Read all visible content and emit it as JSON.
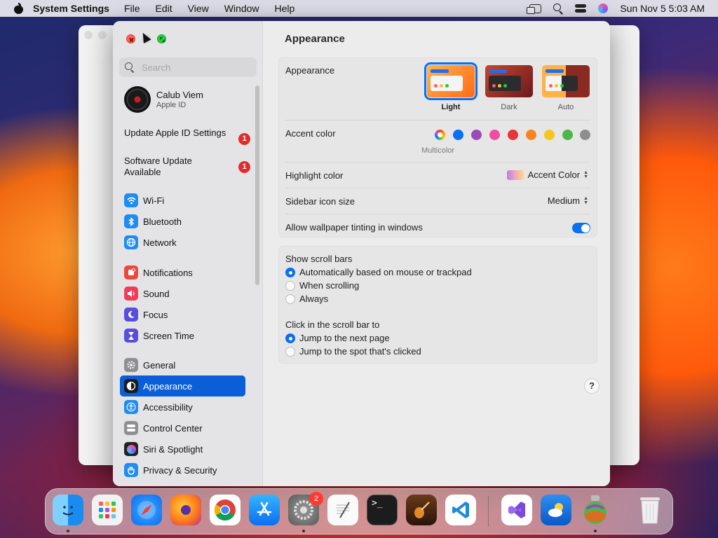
{
  "menubar": {
    "app_name": "System Settings",
    "menus": [
      "File",
      "Edit",
      "View",
      "Window",
      "Help"
    ],
    "clock": "Sun Nov 5  5:03 AM"
  },
  "sidebar": {
    "search_placeholder": "Search",
    "user": {
      "name": "Calub Viem",
      "subtitle": "Apple ID"
    },
    "alerts": [
      {
        "label": "Update Apple ID Settings",
        "badge": "1"
      },
      {
        "label": "Software Update Available",
        "badge": "1"
      }
    ],
    "items": [
      {
        "label": "Wi-Fi",
        "icon": "wifi-icon",
        "color": "#1e8cf0"
      },
      {
        "label": "Bluetooth",
        "icon": "bluetooth-icon",
        "color": "#1e8cf0"
      },
      {
        "label": "Network",
        "icon": "globe-icon",
        "color": "#1e8cf0"
      },
      {
        "label": "Notifications",
        "icon": "bell-icon",
        "color": "#f0463c"
      },
      {
        "label": "Sound",
        "icon": "speaker-icon",
        "color": "#f03c5a"
      },
      {
        "label": "Focus",
        "icon": "moon-icon",
        "color": "#5a4cdc"
      },
      {
        "label": "Screen Time",
        "icon": "hourglass-icon",
        "color": "#5a4cdc"
      },
      {
        "label": "General",
        "icon": "gear-icon",
        "color": "#8e8e93"
      },
      {
        "label": "Appearance",
        "icon": "appearance-icon",
        "color": "#1c1c1e",
        "active": true
      },
      {
        "label": "Accessibility",
        "icon": "accessibility-icon",
        "color": "#1e8cf0"
      },
      {
        "label": "Control Center",
        "icon": "control-center-icon",
        "color": "#8e8e93"
      },
      {
        "label": "Siri & Spotlight",
        "icon": "siri-icon",
        "color": "#222"
      },
      {
        "label": "Privacy & Security",
        "icon": "hand-icon",
        "color": "#1e8cf0"
      }
    ]
  },
  "content": {
    "title": "Appearance",
    "appearance": {
      "label": "Appearance",
      "options": [
        {
          "label": "Light",
          "selected": true
        },
        {
          "label": "Dark",
          "selected": false
        },
        {
          "label": "Auto",
          "selected": false
        }
      ]
    },
    "accent": {
      "label": "Accent color",
      "colors": [
        "multicolor",
        "#0a6ff0",
        "#9a4bb8",
        "#f04ca0",
        "#e8353b",
        "#f5861f",
        "#f6c51e",
        "#4cb748",
        "#8e8e8e"
      ],
      "selected_label": "Multicolor"
    },
    "highlight": {
      "label": "Highlight color",
      "value": "Accent Color"
    },
    "sidebar_icon_size": {
      "label": "Sidebar icon size",
      "value": "Medium"
    },
    "wallpaper_tinting": {
      "label": "Allow wallpaper tinting in windows",
      "enabled": true
    },
    "scroll_bars": {
      "label": "Show scroll bars",
      "options": [
        "Automatically based on mouse or trackpad",
        "When scrolling",
        "Always"
      ],
      "selected": 0
    },
    "click_scroll": {
      "label": "Click in the scroll bar to",
      "options": [
        "Jump to the next page",
        "Jump to the spot that's clicked"
      ],
      "selected": 0
    },
    "help": "?"
  },
  "dock": {
    "apps": [
      "Finder",
      "Launchpad",
      "Safari",
      "Firefox",
      "Chrome",
      "App Store",
      "System Settings",
      "TextEdit",
      "Terminal",
      "GarageBand",
      "Visual Studio Code",
      "Visual Studio",
      "Weather",
      "Simulator",
      "Trash"
    ],
    "settings_badge": "2"
  }
}
